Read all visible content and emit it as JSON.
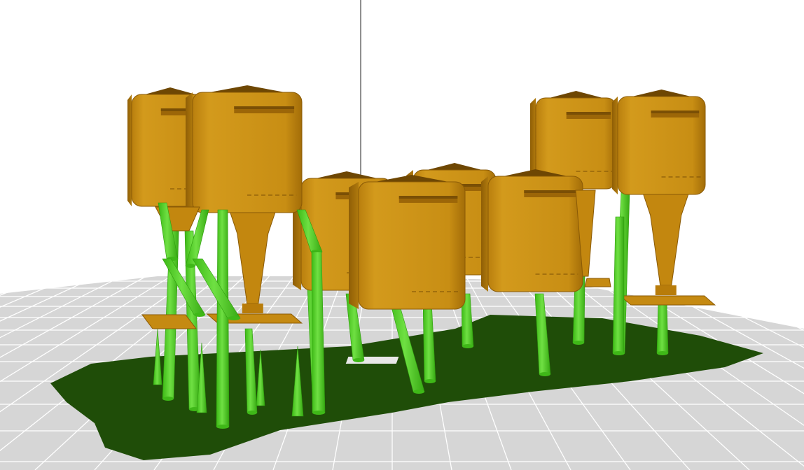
{
  "viewport": {
    "background": "#ffffff",
    "bed_fill": "#d7d7d7",
    "bed_grid": "#ffffff",
    "raft_color": "#1f4d08",
    "support_color": "#4fd623",
    "support_highlight": "#8ff06a",
    "model_color": "#c58a12",
    "model_dark": "#8a5a06",
    "model_light": "#e0a628",
    "axis_color": "#555555"
  },
  "scene": {
    "description_icons": [
      "axis-line",
      "build-plate-grid",
      "raft",
      "support-pillar",
      "mailbox-model"
    ],
    "model_count": 8
  }
}
